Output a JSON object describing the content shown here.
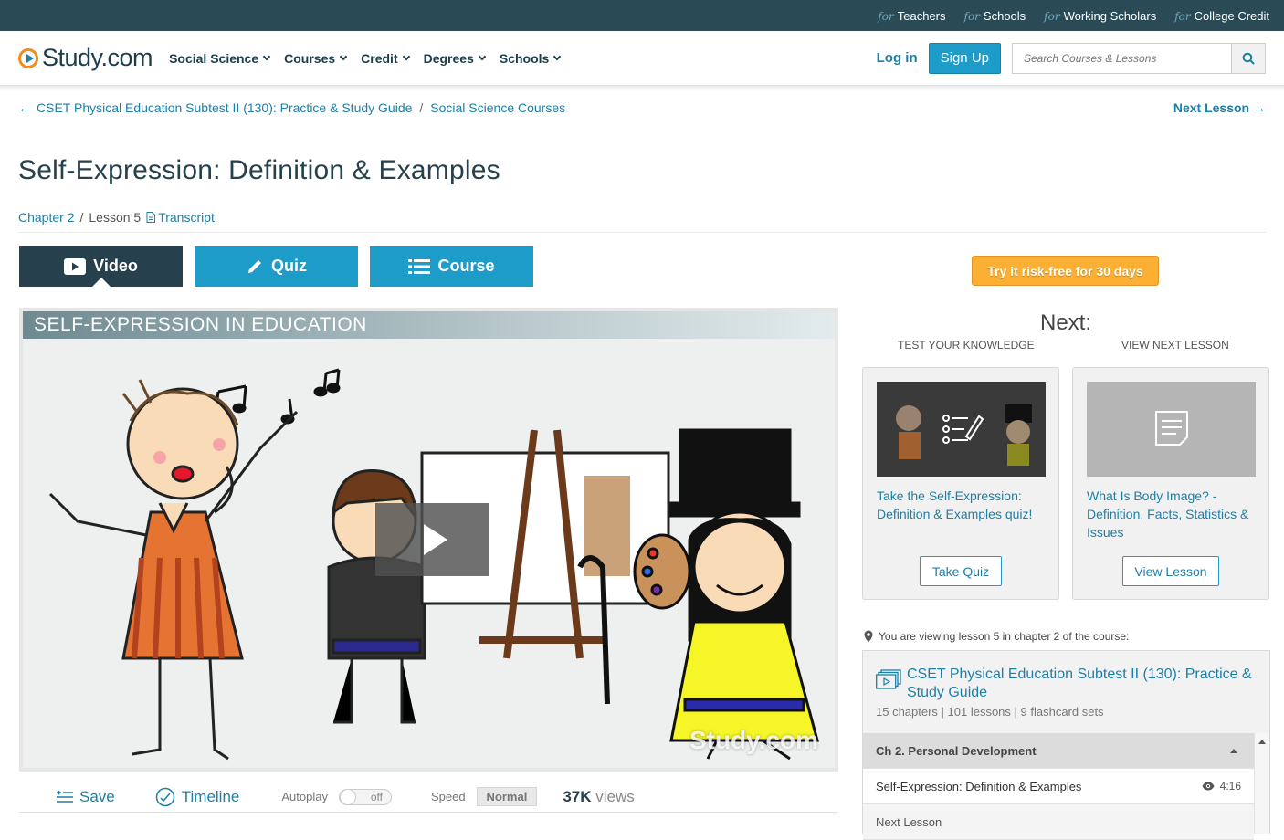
{
  "topbar": {
    "links": [
      {
        "prefix": "for",
        "label": "Teachers"
      },
      {
        "prefix": "for",
        "label": "Schools"
      },
      {
        "prefix": "for",
        "label": "Working Scholars"
      },
      {
        "prefix": "for",
        "label": "College Credit"
      }
    ]
  },
  "header": {
    "logo": "Study.com",
    "nav": [
      "Social Science",
      "Courses",
      "Credit",
      "Degrees",
      "Schools"
    ],
    "login": "Log in",
    "signup": "Sign Up",
    "search_placeholder": "Search Courses & Lessons"
  },
  "breadcrumb": {
    "items": [
      "CSET Physical Education Subtest II (130): Practice & Study Guide",
      "Social Science Courses"
    ],
    "next": "Next Lesson"
  },
  "lesson": {
    "title": "Self-Expression: Definition & Examples",
    "chapter": "Chapter 2",
    "lesson_no": "Lesson 5",
    "transcript": "Transcript"
  },
  "tabs": [
    "Video",
    "Quiz",
    "Course"
  ],
  "video": {
    "banner": "SELF-EXPRESSION IN EDUCATION",
    "watermark": "Study.com"
  },
  "controls": {
    "save": "Save",
    "timeline": "Timeline",
    "autoplay_label": "Autoplay",
    "autoplay_state": "off",
    "speed_label": "Speed",
    "speed_value": "Normal",
    "views_count": "37K",
    "views_label": "views"
  },
  "sidebar": {
    "trial_button": "Try it risk-free for 30 days",
    "next_heading": "Next:",
    "test_label": "TEST YOUR KNOWLEDGE",
    "next_label": "VIEW NEXT LESSON",
    "quiz_card_text": "Take the Self-Expression: Definition & Examples quiz!",
    "quiz_card_button": "Take Quiz",
    "lesson_card_text": "What Is Body Image? - Definition, Facts, Statistics & Issues",
    "lesson_card_button": "View Lesson",
    "viewing_text": "You are viewing lesson 5 in chapter 2 of the course:",
    "course_title": "CSET Physical Education Subtest II (130): Practice & Study Guide",
    "course_stats": "15 chapters | 101 lessons | 9 flashcard sets",
    "chapter_heading": "Ch 2. Personal Development",
    "current_lesson": "Self-Expression: Definition & Examples",
    "current_duration": "4:16",
    "next_lesson_row": "Next Lesson"
  },
  "colors": {
    "brand_dark": "#27404d",
    "brand_blue": "#1d9bc9",
    "link_blue": "#1d7fa6",
    "accent_orange": "#fbb033"
  }
}
